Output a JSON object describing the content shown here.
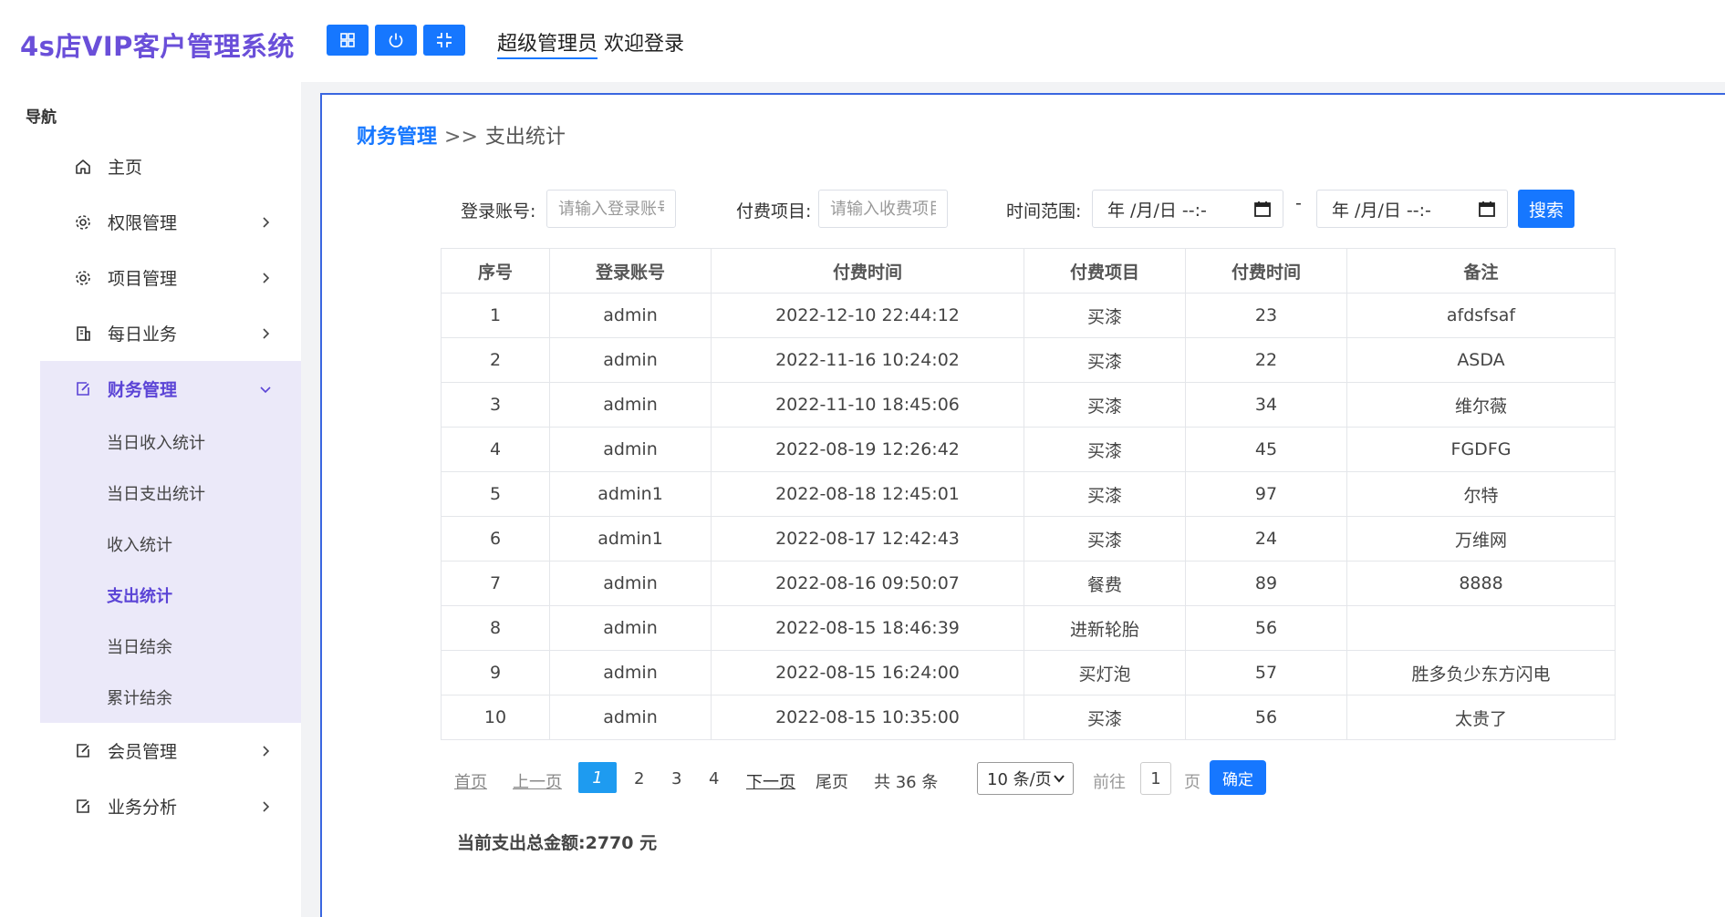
{
  "brand": {
    "title": "4s店VIP客户管理系统"
  },
  "nav": {
    "title": "导航",
    "items": [
      {
        "label": "主页",
        "icon": "home-icon"
      },
      {
        "label": "权限管理",
        "icon": "gear-icon"
      },
      {
        "label": "项目管理",
        "icon": "gear-icon"
      },
      {
        "label": "每日业务",
        "icon": "building-icon"
      },
      {
        "label": "财务管理",
        "icon": "edit-icon"
      },
      {
        "label": "会员管理",
        "icon": "edit-icon"
      },
      {
        "label": "业务分析",
        "icon": "edit-icon"
      }
    ],
    "finance_sub": [
      {
        "label": "当日收入统计"
      },
      {
        "label": "当日支出统计"
      },
      {
        "label": "收入统计"
      },
      {
        "label": "支出统计"
      },
      {
        "label": "当日结余"
      },
      {
        "label": "累计结余"
      }
    ]
  },
  "topbar": {
    "user": "超级管理员",
    "welcome": " 欢迎登录"
  },
  "breadcrumb": {
    "parent": "财务管理",
    "separator": ">>",
    "current": "支出统计"
  },
  "filters": {
    "account_label": "登录账号:",
    "account_placeholder": "请输入登录账号",
    "item_label": "付费项目:",
    "item_placeholder": "请输入收费项目",
    "range_label": "时间范围:",
    "date_placeholder": "年 /月/日 --:-",
    "range_dash": "-",
    "search_label": "搜索"
  },
  "table": {
    "headers": [
      "序号",
      "登录账号",
      "付费时间",
      "付费项目",
      "付费时间",
      "备注"
    ],
    "rows": [
      [
        "1",
        "admin",
        "2022-12-10 22:44:12",
        "买漆",
        "23",
        "afdsfsaf"
      ],
      [
        "2",
        "admin",
        "2022-11-16 10:24:02",
        "买漆",
        "22",
        "ASDA"
      ],
      [
        "3",
        "admin",
        "2022-11-10 18:45:06",
        "买漆",
        "34",
        "维尔薇"
      ],
      [
        "4",
        "admin",
        "2022-08-19 12:26:42",
        "买漆",
        "45",
        "FGDFG"
      ],
      [
        "5",
        "admin1",
        "2022-08-18 12:45:01",
        "买漆",
        "97",
        "尔特"
      ],
      [
        "6",
        "admin1",
        "2022-08-17 12:42:43",
        "买漆",
        "24",
        "万维网"
      ],
      [
        "7",
        "admin",
        "2022-08-16 09:50:07",
        "餐费",
        "89",
        "8888"
      ],
      [
        "8",
        "admin",
        "2022-08-15 18:46:39",
        "进新轮胎",
        "56",
        ""
      ],
      [
        "9",
        "admin",
        "2022-08-15 16:24:00",
        "买灯泡",
        "57",
        "胜多负少东方闪电"
      ],
      [
        "10",
        "admin",
        "2022-08-15 10:35:00",
        "买漆",
        "56",
        "太贵了"
      ]
    ]
  },
  "pager": {
    "first": "首页",
    "prev": "上一页",
    "current": "1",
    "pages": [
      "2",
      "3",
      "4"
    ],
    "next": "下一页",
    "last": "尾页",
    "total": "共 36 条",
    "page_size": "10 条/页",
    "goto_label": "前往",
    "goto_value": "1",
    "page_unit": "页",
    "confirm": "确定"
  },
  "summary": {
    "total_text": "当前支出总金额:2770 元"
  },
  "colors": {
    "brand": "#6a4fd9",
    "primary": "#1677ff",
    "menu_active_bg": "#ebe9f9"
  }
}
